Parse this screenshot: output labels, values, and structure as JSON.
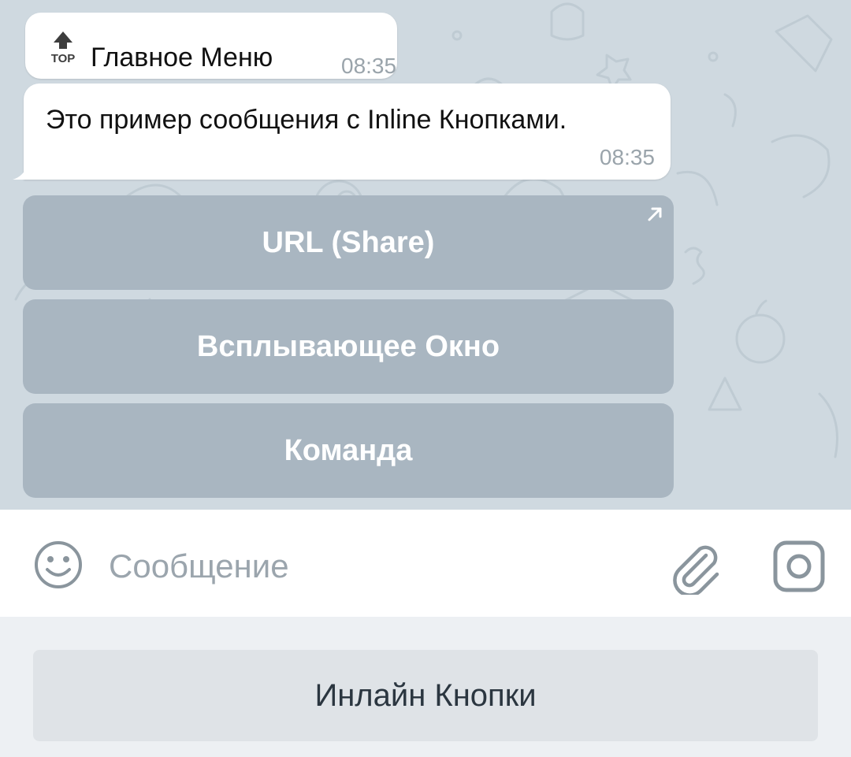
{
  "messages": [
    {
      "text": "Главное Меню",
      "time": "08:35",
      "icon": "top-arrow-icon",
      "icon_label": "TOP"
    },
    {
      "text": "Это пример сообщения с Inline Кнопками.",
      "time": "08:35"
    }
  ],
  "inline_buttons": [
    {
      "label": "URL (Share)",
      "icon": "external-link-arrow-icon"
    },
    {
      "label": "Всплывающее Окно"
    },
    {
      "label": "Команда"
    }
  ],
  "input": {
    "placeholder": "Сообщение",
    "value": ""
  },
  "reply_keyboard": {
    "button_label": "Инлайн Кнопки"
  },
  "icons": [
    "emoji-icon",
    "attach-icon",
    "camera-icon"
  ],
  "colors": {
    "chat_background": "#cfd9e0",
    "inline_button": "#a9b6c1",
    "keyboard_background": "#edf0f3",
    "reply_button": "#dfe3e7",
    "timestamp": "#9aa4ab"
  }
}
